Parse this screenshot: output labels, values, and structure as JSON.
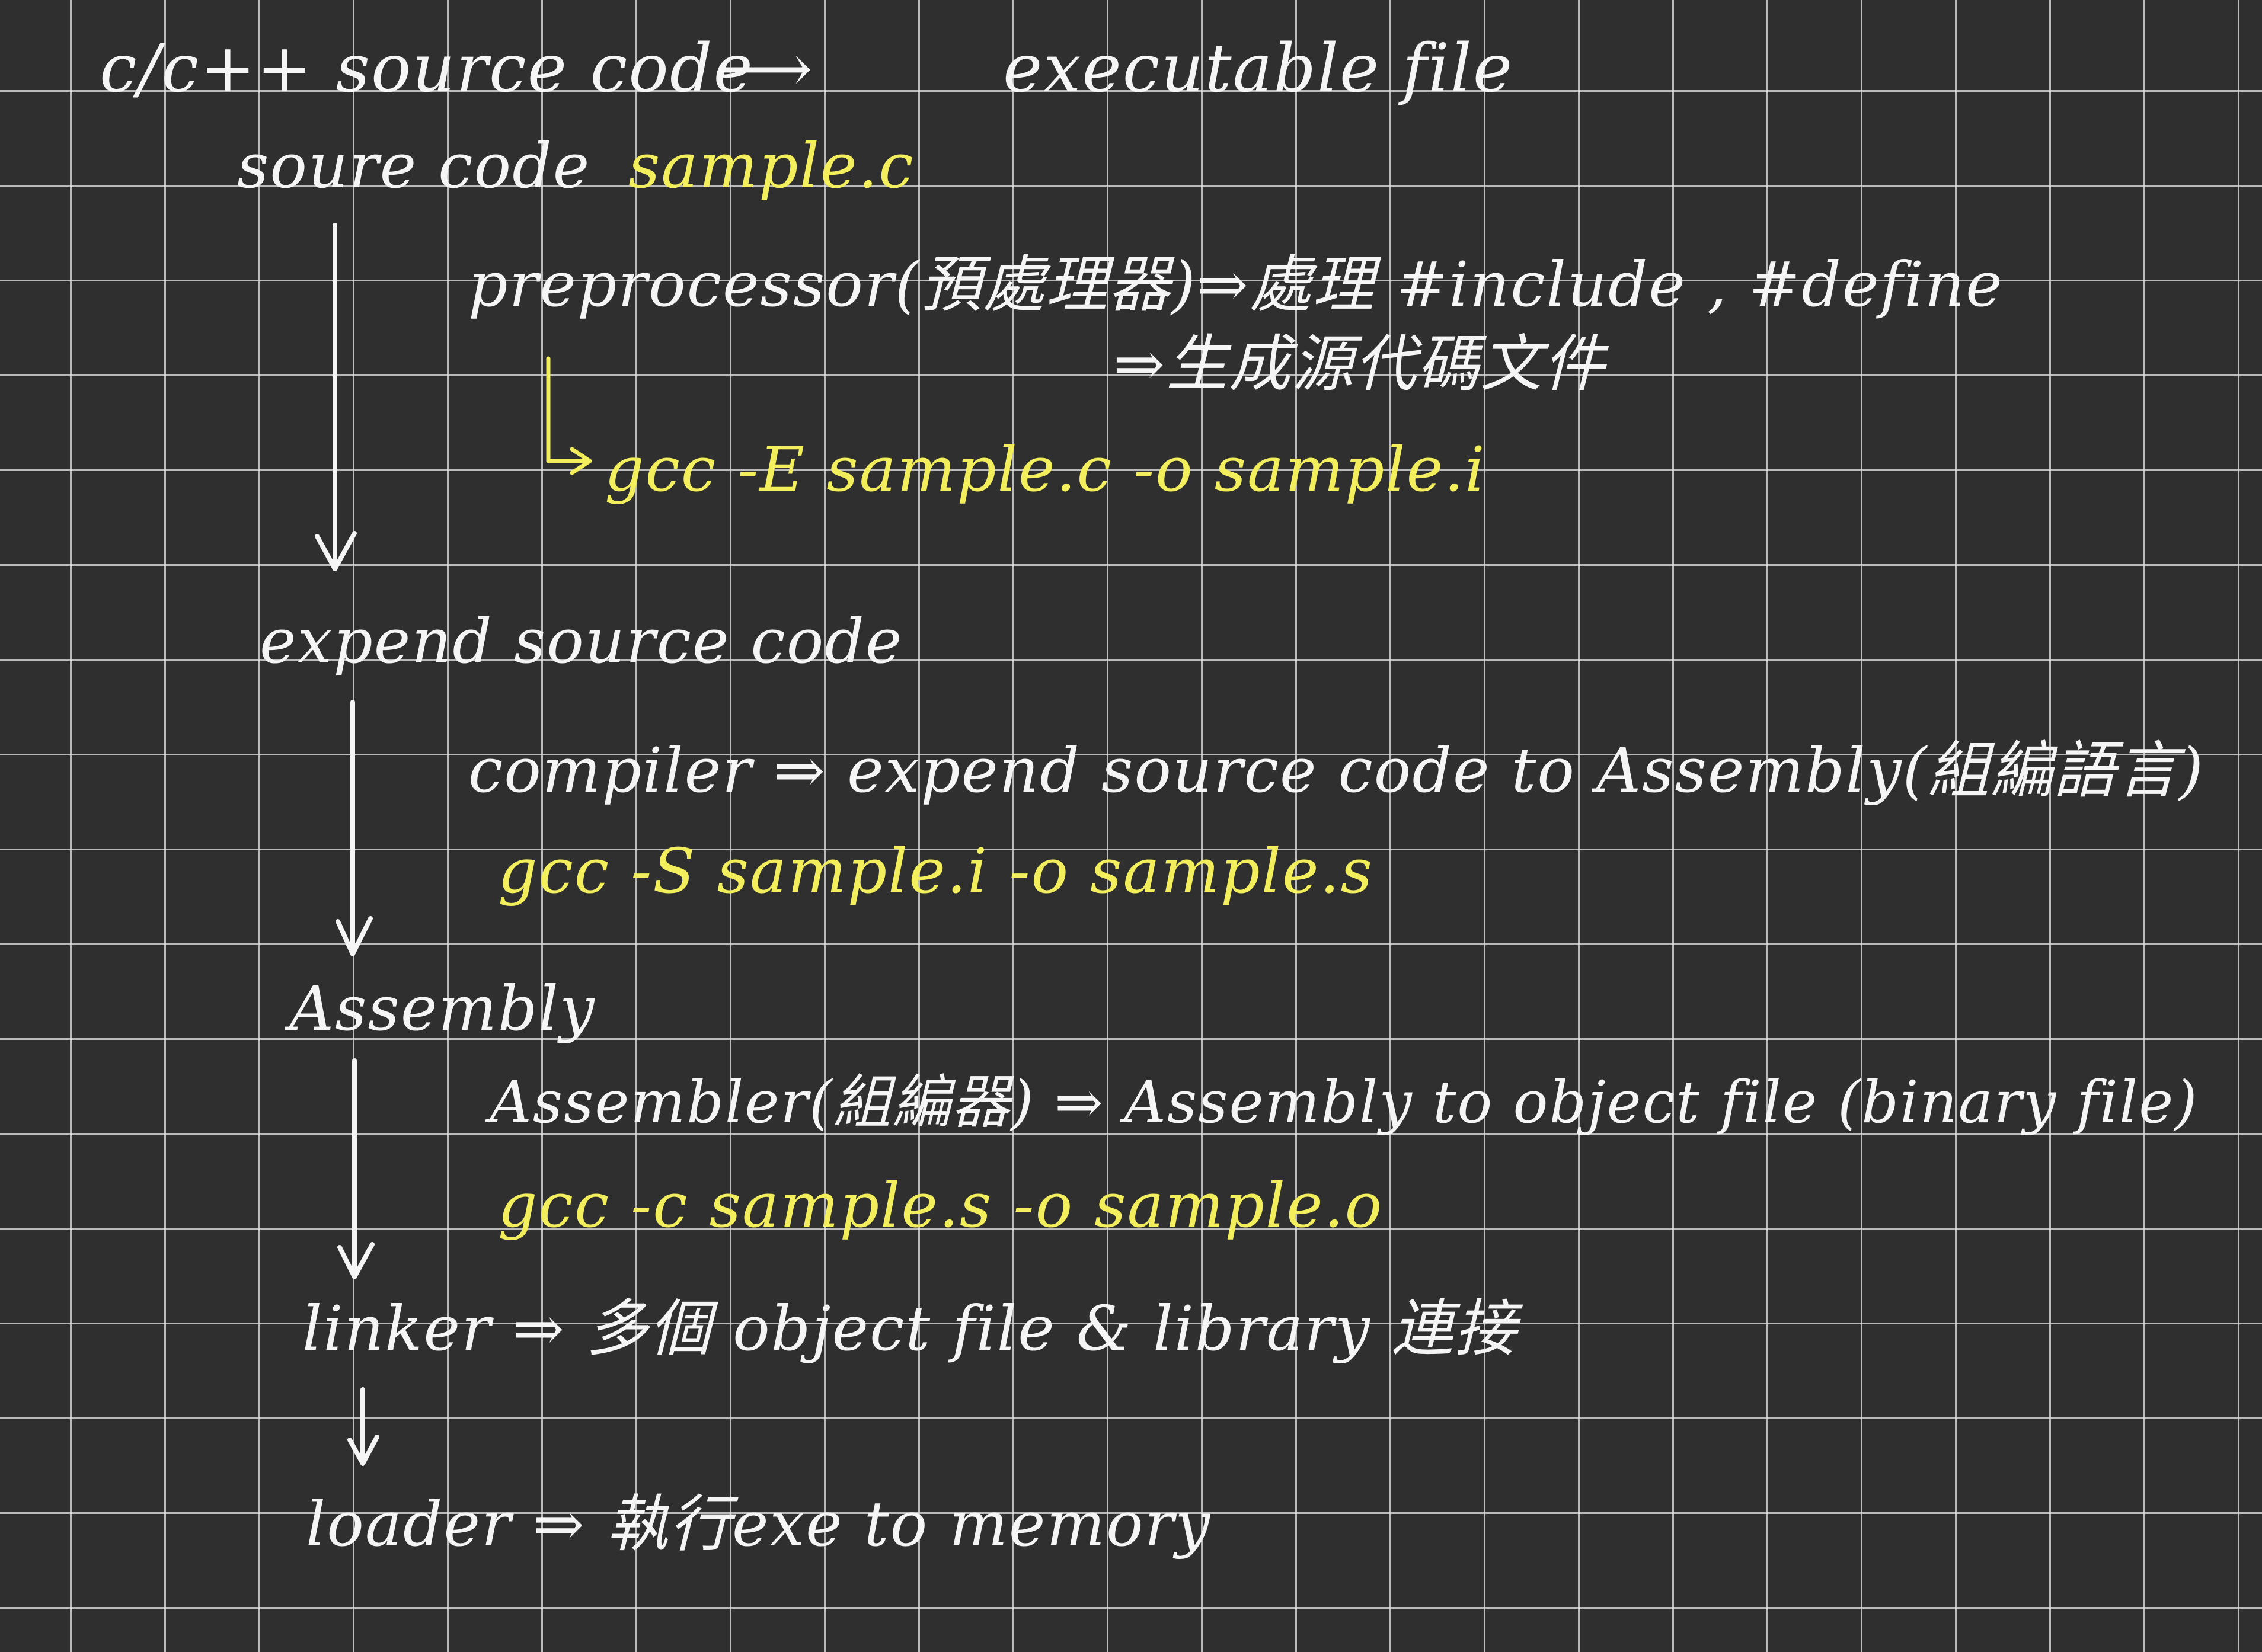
{
  "colors": {
    "background": "#2f2f2f",
    "grid": "#e1e1e1",
    "ink_white": "#f5f5f5",
    "ink_yellow": "#f2ee5c"
  },
  "title": {
    "left": "c/c++ source code",
    "arrow": "⟶",
    "right": "executable file"
  },
  "source": {
    "label": "soure code",
    "file": "sample.c"
  },
  "preprocessor": {
    "line1": "preprocessor(預處理器)⇒處理 #include , #define",
    "line2": "⇒生成源代碼文件",
    "command": "gcc -E  sample.c  -o  sample.i"
  },
  "expand": {
    "label": "expend source code"
  },
  "compiler": {
    "line": "compiler ⇒ expend source code to Assembly(組編語言)",
    "command": "gcc -S  sample.i -o  sample.s"
  },
  "assembly": {
    "label": "Assembly"
  },
  "assembler": {
    "line": "Assembler(組編器) ⇒ Assembly to object file (binary file)",
    "command": "gcc -c  sample.s -o  sample.o"
  },
  "linker": {
    "line": "linker ⇒ 多個 object file & library 連接"
  },
  "loader": {
    "line": "loader ⇒ 執行exe to memory"
  }
}
